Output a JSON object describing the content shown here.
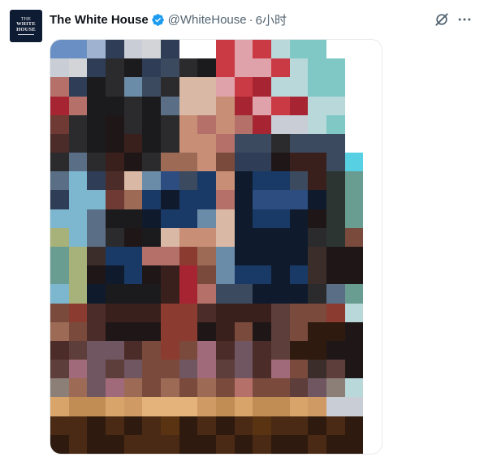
{
  "tweet": {
    "avatar_text": [
      "THE",
      "WHITE",
      "HOUSE"
    ],
    "display_name": "The White House",
    "handle": "@WhiteHouse",
    "separator": "·",
    "time": "6小时",
    "verified_icon": "verified-badge-icon",
    "grok_icon": "grok-icon",
    "more_icon": "more-options-icon",
    "colors": {
      "verified": "#1d9bf0",
      "muted": "#536471",
      "name": "#0f1419"
    }
  },
  "media": {
    "kind": "pixelated-image",
    "palette": [
      "#6a8fc4",
      "#9fb2cf",
      "#2f3d57",
      "#ffffff",
      "#c9cdd5",
      "#d2d4d8",
      "#c93a44",
      "#e0a2aa",
      "#b8d8da",
      "#7fc8c6",
      "#2b2b2e",
      "#1b1b1e",
      "#8c7f78",
      "#3b4a5e",
      "#d9b9a6",
      "#c98f76",
      "#b5706a",
      "#e8e4df",
      "#8ac2d6",
      "#0f1a2c",
      "#193a66",
      "#2d4c7f",
      "#6b8ca8",
      "#5a6f86",
      "#a72532",
      "#6e3a33",
      "#4b2c28",
      "#3a201d",
      "#5e3e3b",
      "#7a4a3c",
      "#9c6a55",
      "#d9a46a",
      "#c28d55",
      "#4a2a15",
      "#2e1a0e",
      "#a64f42",
      "#7cb7cf",
      "#3b2d2a",
      "#a7b27a",
      "#2c3531",
      "#58d0e4",
      "#6a9d91",
      "#1f1717",
      "#c56c59",
      "#8b3b2f",
      "#705660",
      "#a06a7a",
      "#e4b37b",
      "#cf9a64",
      "#5a3313"
    ]
  }
}
